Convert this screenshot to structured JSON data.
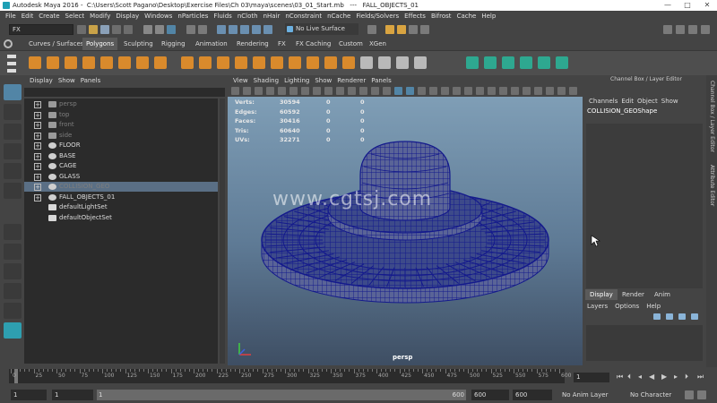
{
  "window": {
    "title": "Autodesk Maya 2016 -  C:\\Users\\Scott Pagano\\Desktop\\Exercise Files\\Ch 03\\maya\\scenes\\03_01_Start.mb   ---   FALL_OBJECTS_01",
    "minimize": "—",
    "maximize": "□",
    "close": "✕"
  },
  "menubar": [
    "File",
    "Edit",
    "Create",
    "Select",
    "Modify",
    "Display",
    "Windows",
    "nParticles",
    "Fluids",
    "nCloth",
    "nHair",
    "nConstraint",
    "nCache",
    "Fields/Solvers",
    "Effects",
    "Bifrost",
    "Cache",
    "Help"
  ],
  "status": {
    "mode": "FX",
    "live_surface": "No Live Surface"
  },
  "shelf_tabs": [
    "Curves / Surfaces",
    "Polygons",
    "Sculpting",
    "Rigging",
    "Animation",
    "Rendering",
    "FX",
    "FX Caching",
    "Custom",
    "XGen"
  ],
  "shelf_active": "Polygons",
  "outliner": {
    "menu": [
      "Display",
      "Show",
      "Panels"
    ],
    "items": [
      {
        "label": "persp",
        "kind": "camera"
      },
      {
        "label": "top",
        "kind": "camera"
      },
      {
        "label": "front",
        "kind": "camera"
      },
      {
        "label": "side",
        "kind": "camera"
      },
      {
        "label": "FLOOR",
        "kind": "transform"
      },
      {
        "label": "BASE",
        "kind": "transform"
      },
      {
        "label": "CAGE",
        "kind": "transform"
      },
      {
        "label": "GLASS",
        "kind": "transform"
      },
      {
        "label": "COLLISION_GEO",
        "kind": "transform"
      },
      {
        "label": "FALL_OBJECTS_01",
        "kind": "transform"
      },
      {
        "label": "defaultLightSet",
        "kind": "set"
      },
      {
        "label": "defaultObjectSet",
        "kind": "set"
      }
    ]
  },
  "viewport": {
    "menu": [
      "View",
      "Shading",
      "Lighting",
      "Show",
      "Renderer",
      "Panels"
    ],
    "hud": [
      {
        "label": "Verts:",
        "v1": "30594",
        "v2": "0",
        "v3": "0"
      },
      {
        "label": "Edges:",
        "v1": "60592",
        "v2": "0",
        "v3": "0"
      },
      {
        "label": "Faces:",
        "v1": "30416",
        "v2": "0",
        "v3": "0"
      },
      {
        "label": "Tris:",
        "v1": "60640",
        "v2": "0",
        "v3": "0"
      },
      {
        "label": "UVs:",
        "v1": "32271",
        "v2": "0",
        "v3": "0"
      }
    ],
    "watermark": "www.cgtsj.com",
    "camera": "persp",
    "vp_values": {
      "a": "0.00",
      "b": "1.00"
    }
  },
  "channel_box": {
    "title": "Channel Box / Layer Editor",
    "menu": [
      "Channels",
      "Edit",
      "Object",
      "Show"
    ],
    "object": "COLLISION_GEOShape",
    "layer_tabs": [
      "Display",
      "Render",
      "Anim"
    ],
    "layer_active": "Display",
    "layer_menu": [
      "Layers",
      "Options",
      "Help"
    ],
    "side_tabs": [
      "Channel Box / Layer Editor",
      "Attribute Editor"
    ]
  },
  "timeline": {
    "ticks": [
      "0",
      "25",
      "50",
      "75",
      "100",
      "125",
      "150",
      "175",
      "200",
      "225",
      "250",
      "275",
      "300",
      "325",
      "350",
      "375",
      "400",
      "425",
      "450",
      "475",
      "500",
      "525",
      "550",
      "575",
      "600"
    ],
    "current_frame": "1",
    "playhead_frame": 1
  },
  "range": {
    "start": "1",
    "playback_start": "1",
    "slider_start": "1",
    "slider_end": "600",
    "playback_end": "600",
    "end": "600",
    "anim_layer": "No Anim Layer",
    "character_set": "No Character Set"
  },
  "colors": {
    "selection": "#5a6f85",
    "shelf_orange": "#d98a2c",
    "shelf_green": "#2ea890",
    "mesh": "#141a8c"
  }
}
